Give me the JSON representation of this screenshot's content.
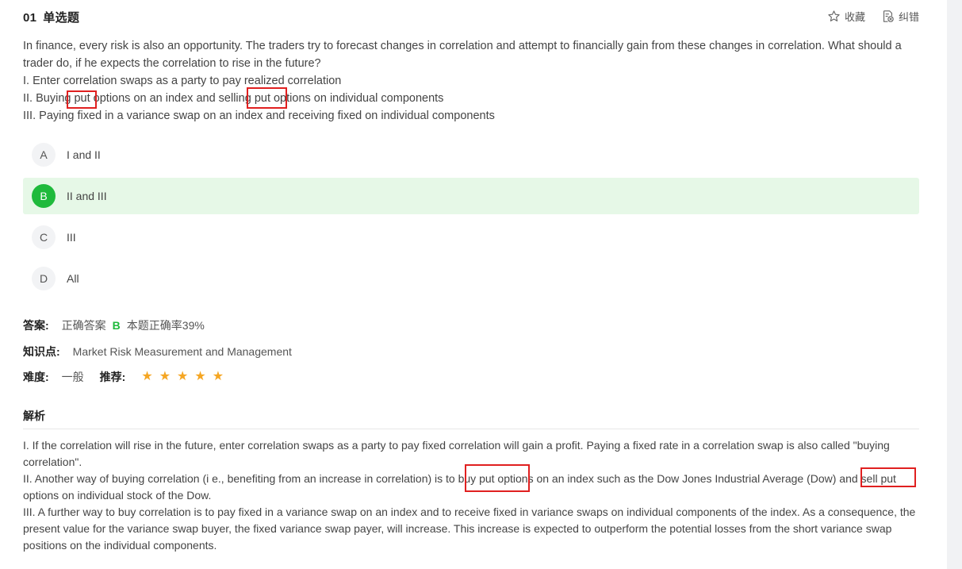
{
  "question": {
    "number": "01",
    "type": "单选题",
    "actions": {
      "favorite_label": "收藏",
      "report_label": "纠错"
    },
    "stem": [
      "In finance, every risk is also an opportunity. The traders try to forecast changes in correlation and attempt to financially gain from these changes in correlation. What should a trader do, if he expects the correlation to rise in the future?",
      "I. Enter correlation swaps as a party to pay realized correlation",
      "II. Buying put options on an index and selling put options on individual components",
      "III. Paying fixed in a variance swap on an index and receiving fixed on individual components"
    ],
    "options": [
      {
        "letter": "A",
        "text": "I and II"
      },
      {
        "letter": "B",
        "text": "II and III"
      },
      {
        "letter": "C",
        "text": "III"
      },
      {
        "letter": "D",
        "text": "All"
      }
    ],
    "correct_option": "B"
  },
  "answer": {
    "label": "答案:",
    "correct_prefix": "正确答案",
    "correct_letter": "B",
    "accuracy_text": "本题正确率39%"
  },
  "knowledge": {
    "label": "知识点:",
    "value": "Market Risk Measurement and Management"
  },
  "difficulty": {
    "label": "难度:",
    "value": "一般",
    "recommend_label": "推荐:",
    "stars": 5
  },
  "analysis": {
    "title": "解析",
    "paragraphs": [
      "I. If the correlation will rise in the future, enter correlation swaps as a party to pay fixed correlation will gain a profit. Paying a fixed rate in a correlation swap is also called \"buying correlation\".",
      "II. Another way of buying correlation (i e., benefiting from an increase in correlation) is to buy put options on an index such as the Dow Jones Industrial Average (Dow) and sell put options on individual stock of the Dow.",
      "III. A further way to buy correlation is to pay fixed in a variance swap on an index and to receive fixed in variance swaps on individual components of the index. As a consequence, the present value for the variance swap buyer, the fixed variance swap payer, will increase. This increase is expected to outperform the potential losses from the short variance swap positions on the individual components."
    ]
  },
  "colors": {
    "accent_green": "#1fba3c",
    "correct_bg": "#e6f8e7",
    "annotation_red": "#e02020",
    "star": "#f5a623"
  }
}
